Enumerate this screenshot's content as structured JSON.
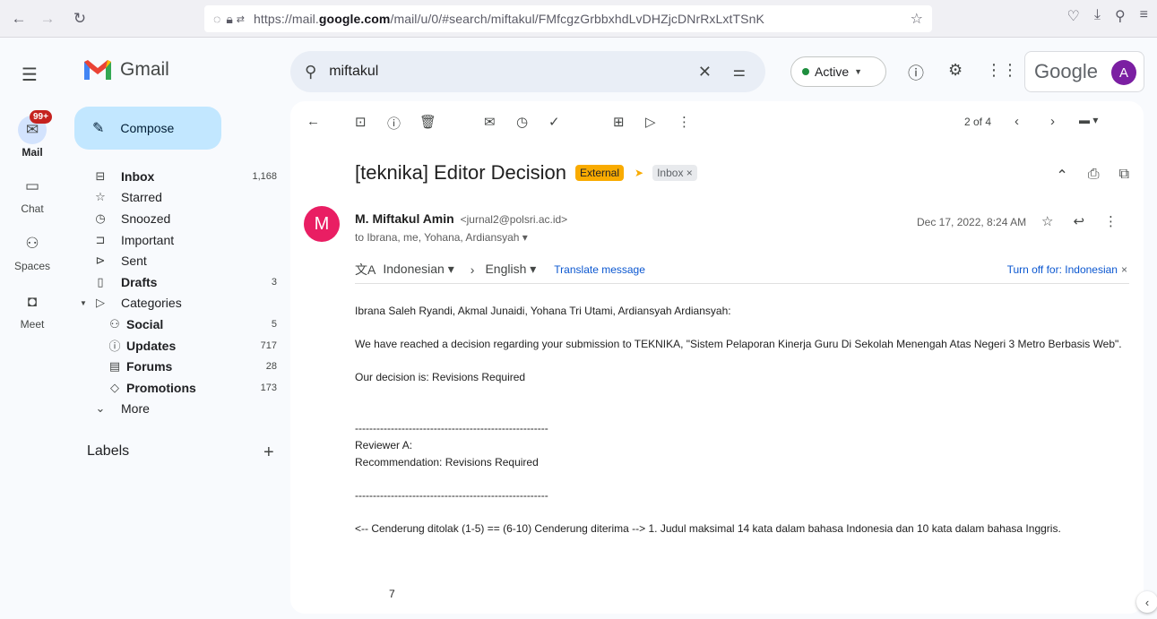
{
  "browser": {
    "url_prefix": "https://mail.",
    "url_domain": "google.com",
    "url_path": "/mail/u/0/#search/miftakul/FMfcgzGrbbxhdLvDHZjcDNrRxLxtTSnK"
  },
  "rail": {
    "mail_label": "Mail",
    "mail_badge": "99+",
    "chat_label": "Chat",
    "spaces_label": "Spaces",
    "meet_label": "Meet"
  },
  "logo": {
    "word": "Gmail"
  },
  "compose": {
    "label": "Compose"
  },
  "folders": [
    {
      "name": "Inbox",
      "count": "1,168",
      "bold": true
    },
    {
      "name": "Starred",
      "count": ""
    },
    {
      "name": "Snoozed",
      "count": ""
    },
    {
      "name": "Important",
      "count": ""
    },
    {
      "name": "Sent",
      "count": ""
    },
    {
      "name": "Drafts",
      "count": "3",
      "bold": true
    },
    {
      "name": "Categories",
      "count": ""
    },
    {
      "name": "Social",
      "count": "5",
      "bold": true
    },
    {
      "name": "Updates",
      "count": "717",
      "bold": true
    },
    {
      "name": "Forums",
      "count": "28",
      "bold": true
    },
    {
      "name": "Promotions",
      "count": "173",
      "bold": true
    },
    {
      "name": "More",
      "count": ""
    }
  ],
  "labels": {
    "heading": "Labels"
  },
  "search": {
    "value": "miftakul"
  },
  "status": {
    "label": "Active"
  },
  "google": {
    "word": "Google",
    "avatar_letter": "A"
  },
  "toolbar": {
    "pager": "2 of 4"
  },
  "message": {
    "subject": "[teknika] Editor Decision",
    "tag_external": "External",
    "tag_inbox": "Inbox ×",
    "sender_initial": "M",
    "sender_name": "M. Miftakul Amin",
    "sender_email": "<jurnal2@polsri.ac.id>",
    "recipients": "to Ibrana, me, Yohana, Ardiansyah ▾",
    "date": "Dec 17, 2022, 8:24 AM"
  },
  "translate": {
    "from": "Indonesian",
    "to": "English",
    "link": "Translate message",
    "turn_off": "Turn off for: Indonesian"
  },
  "body": {
    "greeting": "Ibrana Saleh Ryandi, Akmal Junaidi, Yohana Tri Utami, Ardiansyah Ardiansyah:",
    "para1": "We have reached a decision regarding your submission to TEKNIKA, \"Sistem Pelaporan Kinerja Guru Di Sekolah Menengah Atas Negeri 3 Metro Berbasis Web\".",
    "para2": "Our decision is: Revisions Required",
    "separator1": "------------------------------------------------------",
    "reviewer": "Reviewer A:",
    "recommendation": "Recommendation: Revisions Required",
    "separator2": "------------------------------------------------------",
    "scale": "<-- Cenderung ditolak (1-5) == (6-10) Cenderung diterima --> 1. Judul maksimal 14 kata dalam bahasa Indonesia dan 10 kata dalam bahasa Inggris.",
    "number": "7"
  }
}
